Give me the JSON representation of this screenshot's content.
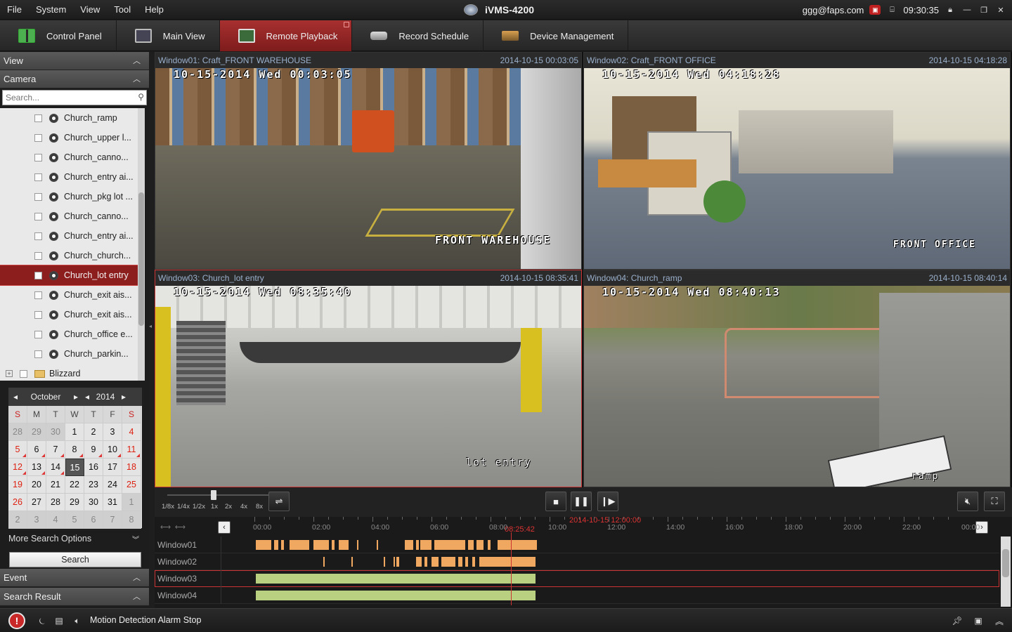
{
  "menu": {
    "file": "File",
    "system": "System",
    "view": "View",
    "tool": "Tool",
    "help": "Help"
  },
  "app_title": "iVMS-4200",
  "user": "ggg@faps.com",
  "clock": "09:30:35",
  "tabs": [
    {
      "label": "Control Panel",
      "icon": "grid-icon"
    },
    {
      "label": "Main View",
      "icon": "monitor-icon"
    },
    {
      "label": "Remote Playback",
      "icon": "playback-icon",
      "active": true
    },
    {
      "label": "Record Schedule",
      "icon": "camera-schedule-icon"
    },
    {
      "label": "Device Management",
      "icon": "device-icon"
    }
  ],
  "left": {
    "view_title": "View",
    "camera_title": "Camera",
    "search_placeholder": "Search...",
    "cameras": [
      {
        "label": "Church_ramp"
      },
      {
        "label": "Church_upper l..."
      },
      {
        "label": "Church_canno..."
      },
      {
        "label": "Church_entry ai..."
      },
      {
        "label": "Church_pkg lot ..."
      },
      {
        "label": "Church_canno..."
      },
      {
        "label": "Church_entry ai..."
      },
      {
        "label": "Church_church..."
      },
      {
        "label": "Church_lot entry",
        "selected": true
      },
      {
        "label": "Church_exit ais..."
      },
      {
        "label": "Church_exit ais..."
      },
      {
        "label": "Church_office e..."
      },
      {
        "label": "Church_parkin..."
      }
    ],
    "folder": "Blizzard",
    "more_search": "More Search Options",
    "search_button": "Search",
    "event_title": "Event",
    "result_title": "Search Result"
  },
  "calendar": {
    "month": "October",
    "year": "2014",
    "weekdays": [
      "S",
      "M",
      "T",
      "W",
      "T",
      "F",
      "S"
    ],
    "days": [
      [
        "28",
        "29",
        "30",
        "1",
        "2",
        "3",
        "4"
      ],
      [
        "5",
        "6",
        "7",
        "8",
        "9",
        "10",
        "11"
      ],
      [
        "12",
        "13",
        "14",
        "15",
        "16",
        "17",
        "18"
      ],
      [
        "19",
        "20",
        "21",
        "22",
        "23",
        "24",
        "25"
      ],
      [
        "26",
        "27",
        "28",
        "29",
        "30",
        "31",
        "1"
      ],
      [
        "2",
        "3",
        "4",
        "5",
        "6",
        "7",
        "8"
      ]
    ],
    "today": "15"
  },
  "windows": [
    {
      "title": "Window01:  Craft_FRONT WAREHOUSE",
      "time": "2014-10-15 00:03:05",
      "osd_date": "10-15-2014 Wed 00:03:05",
      "osd_name": "FRONT WAREHOUSE"
    },
    {
      "title": "Window02:  Craft_FRONT OFFICE",
      "time": "2014-10-15 04:18:28",
      "osd_date": "10-15-2014 Wed 04:18:28",
      "osd_name": "FRONT OFFICE"
    },
    {
      "title": "Window03:  Church_lot entry",
      "time": "2014-10-15 08:35:41",
      "osd_date": "10-15-2014 Wed 08:35:40",
      "osd_name": "lot entry"
    },
    {
      "title": "Window04:  Church_ramp",
      "time": "2014-10-15 08:40:14",
      "osd_date": "10-15-2014 Wed 08:40:13",
      "osd_name": "ramp"
    }
  ],
  "speeds": [
    "1/8x",
    "1/4x",
    "1/2x",
    "1x",
    "2x",
    "4x",
    "8x"
  ],
  "timeline": {
    "current": "08:25:42",
    "center": "2014-10-15 12:00:00",
    "hours": [
      "00:00",
      "02:00",
      "04:00",
      "06:00",
      "08:00",
      "10:00",
      "12:00",
      "14:00",
      "16:00",
      "18:00",
      "20:00",
      "22:00",
      "00:00"
    ],
    "rows": [
      "Window01",
      "Window02",
      "Window03",
      "Window04"
    ]
  },
  "status": {
    "message": "Motion Detection Alarm Stop"
  },
  "colors": {
    "accent": "#8d1e1e",
    "motion": "#f0a860",
    "continuous": "#b8d080"
  }
}
